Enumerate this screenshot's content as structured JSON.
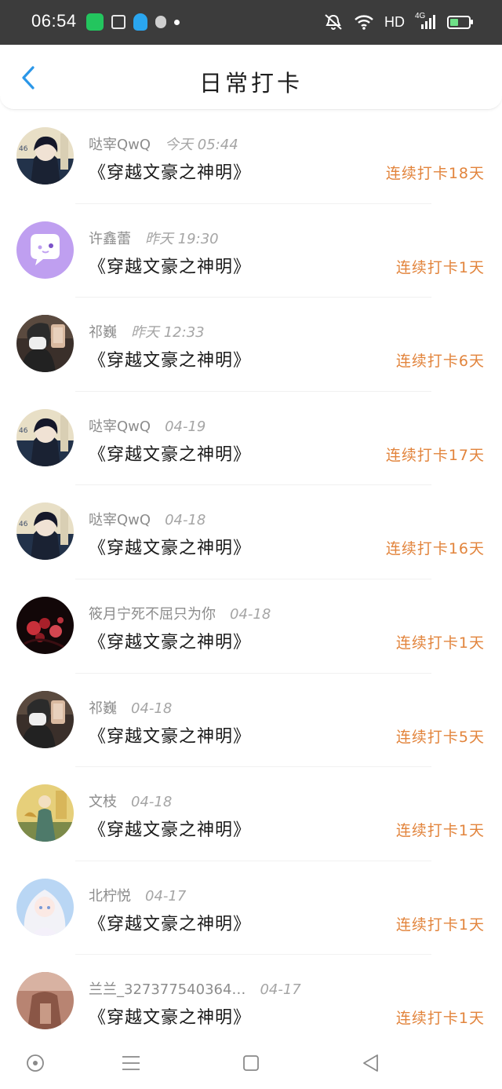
{
  "status": {
    "time": "06:54",
    "hd_label": "HD",
    "network_label": "4G"
  },
  "header": {
    "title": "日常打卡"
  },
  "items": [
    {
      "name": "哒宰QwQ",
      "time": "今天 05:44",
      "book": "《穿越文豪之神明》",
      "streak": "连续打卡18天",
      "avatar": "anime-dark"
    },
    {
      "name": "许鑫蕾",
      "time": "昨天 19:30",
      "book": "《穿越文豪之神明》",
      "streak": "连续打卡1天",
      "avatar": "purple-chat"
    },
    {
      "name": "祁巍",
      "time": "昨天 12:33",
      "book": "《穿越文豪之神明》",
      "streak": "连续打卡6天",
      "avatar": "masked-person"
    },
    {
      "name": "哒宰QwQ",
      "time": "04-19",
      "book": "《穿越文豪之神明》",
      "streak": "连续打卡17天",
      "avatar": "anime-dark"
    },
    {
      "name": "哒宰QwQ",
      "time": "04-18",
      "book": "《穿越文豪之神明》",
      "streak": "连续打卡16天",
      "avatar": "anime-dark"
    },
    {
      "name": "筱月宁死不屈只为你",
      "time": "04-18",
      "book": "《穿越文豪之神明》",
      "streak": "连续打卡1天",
      "avatar": "red-flowers"
    },
    {
      "name": "祁巍",
      "time": "04-18",
      "book": "《穿越文豪之神明》",
      "streak": "连续打卡5天",
      "avatar": "masked-person"
    },
    {
      "name": "文枝",
      "time": "04-18",
      "book": "《穿越文豪之神明》",
      "streak": "连续打卡1天",
      "avatar": "painting-yellow"
    },
    {
      "name": "北柠悦",
      "time": "04-17",
      "book": "《穿越文豪之神明》",
      "streak": "连续打卡1天",
      "avatar": "anime-white-hair"
    },
    {
      "name": "兰兰_327377540364…",
      "time": "04-17",
      "book": "《穿越文豪之神明》",
      "streak": "连续打卡1天",
      "avatar": "brown-photo"
    }
  ],
  "colors": {
    "accent_blue": "#2b97e8",
    "streak_orange": "#e2843c"
  }
}
